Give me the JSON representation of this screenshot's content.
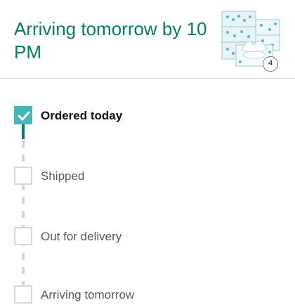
{
  "header": {
    "headline": "Arriving tomorrow by 10 PM",
    "product_thumbnail": "tissue-box-multipack-image",
    "quantity_badge": "4"
  },
  "tracker": {
    "accent_color": "#44b7b8",
    "steps": [
      {
        "label": "Ordered today",
        "completed": true,
        "icon": "checkmark-icon"
      },
      {
        "label": "Shipped",
        "completed": false
      },
      {
        "label": "Out for delivery",
        "completed": false
      },
      {
        "label": "Arriving tomorrow",
        "completed": false
      }
    ]
  }
}
